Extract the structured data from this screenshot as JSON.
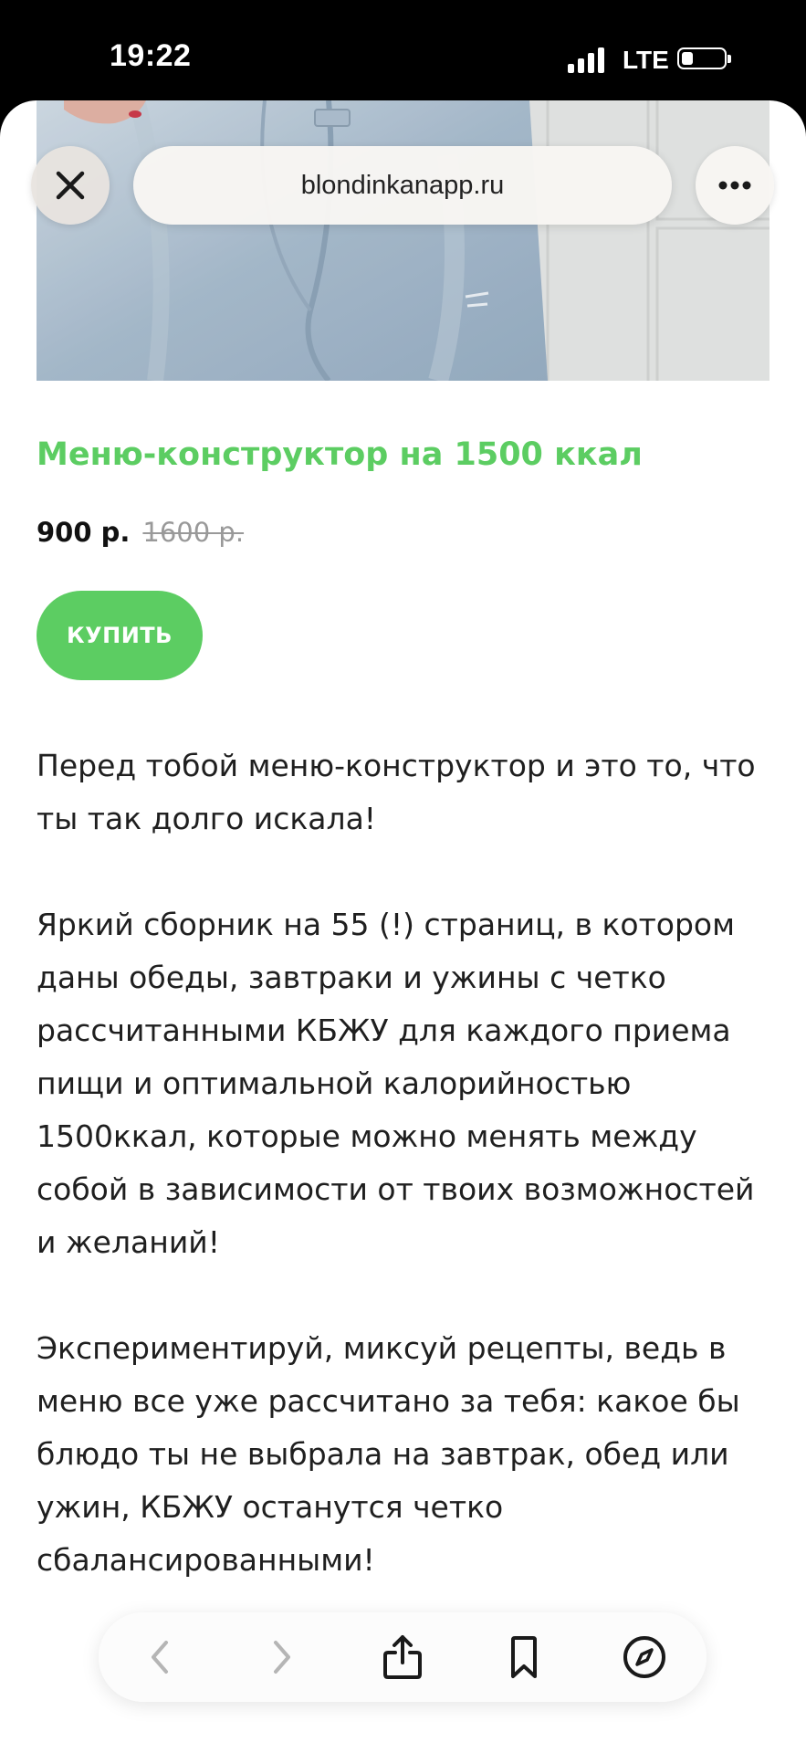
{
  "status_bar": {
    "time": "19:22",
    "network": "LTE",
    "icons": [
      "signal-icon",
      "battery-icon"
    ]
  },
  "browser": {
    "url": "blondinkanapp.ru",
    "icons": [
      "close-icon",
      "more-icon",
      "back-icon",
      "forward-icon",
      "share-icon",
      "bookmark-icon",
      "compass-icon"
    ]
  },
  "product": {
    "title": "Меню-конструктор на 1500 ккал",
    "price": "900 р.",
    "old_price": "1600 р.",
    "buy_label": "КУПИТЬ"
  },
  "description": [
    "Перед тобой меню-конструктор и это то, что ты так долго искала!",
    "Яркий сборник на 55 (!) страниц, в котором даны обеды, завтраки и ужины с четко рассчитанными КБЖУ для каждого приема пищи и оптимальной калорийностью 1500ккал, которые можно менять между собой в зависимости от твоих возможностей и желаний!",
    "Экспериментируй, миксуй рецепты, ведь в меню все уже рассчитано за тебя: какое бы блюдо ты не выбрала на завтрак, обед или ужин, КБЖУ останутся четко сбалансированными!"
  ],
  "colors": {
    "accent": "#5ccd62",
    "text": "#1f1f1f",
    "old_price": "#999999"
  }
}
